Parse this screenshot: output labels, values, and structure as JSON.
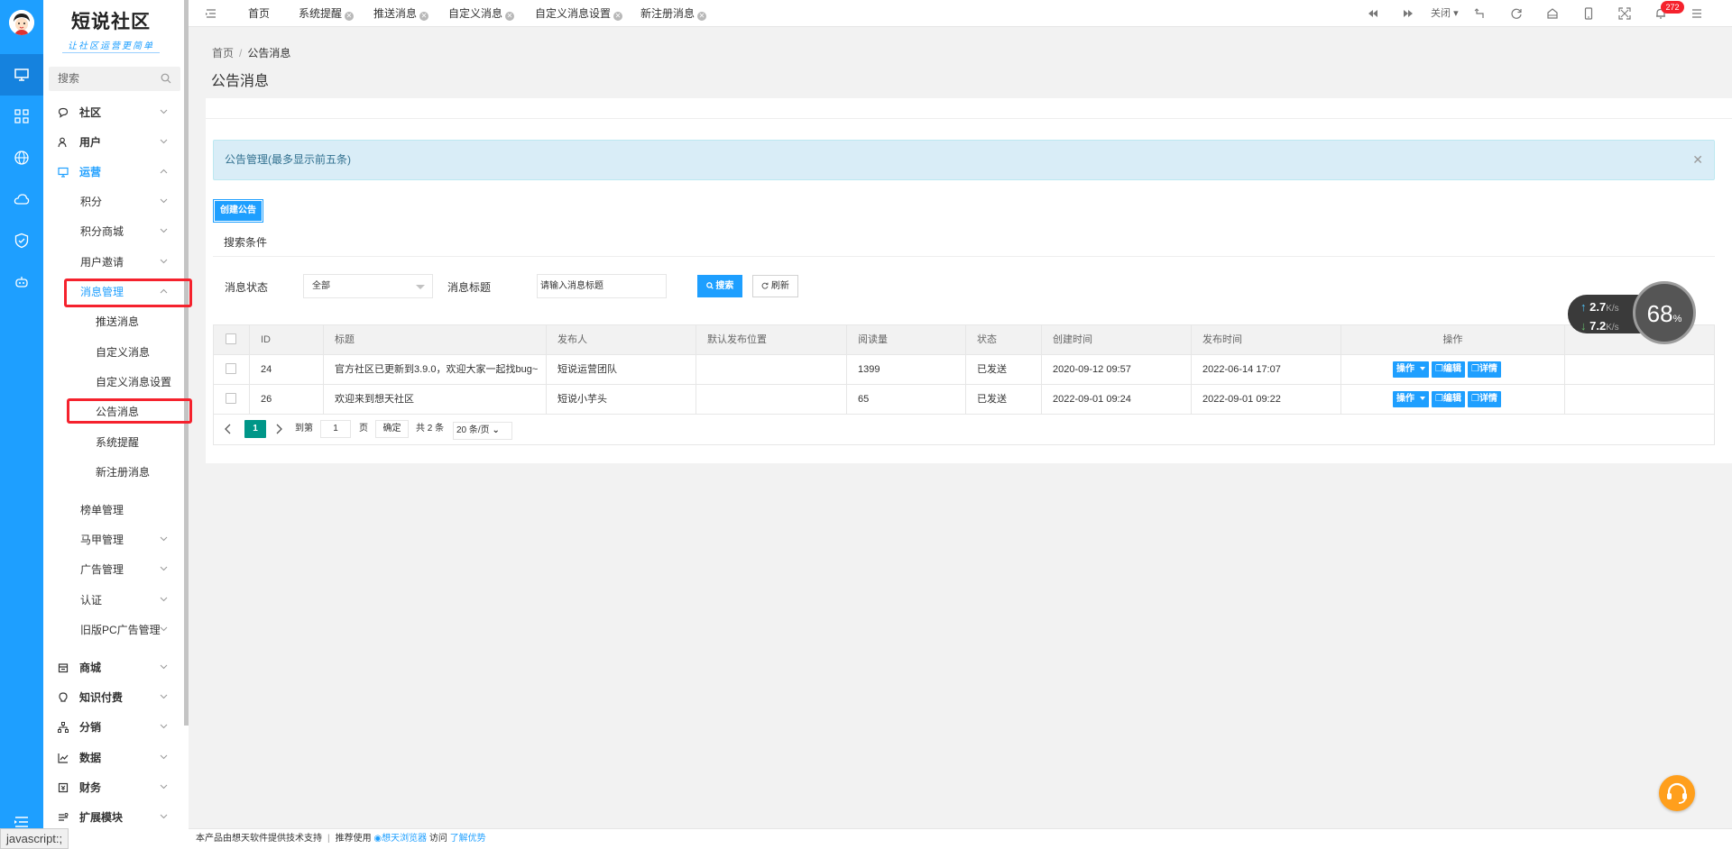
{
  "brand": {
    "title": "短说社区",
    "slogan": "让社区运营更简单"
  },
  "search": {
    "placeholder": "搜索"
  },
  "menu": [
    {
      "label": "社区",
      "icon": "chat-icon"
    },
    {
      "label": "用户",
      "icon": "users-icon"
    },
    {
      "label": "运营",
      "icon": "monitor-icon"
    },
    {
      "label": "积分"
    },
    {
      "label": "积分商城"
    },
    {
      "label": "用户邀请"
    },
    {
      "label": "消息管理"
    },
    {
      "label": "推送消息"
    },
    {
      "label": "自定义消息"
    },
    {
      "label": "自定义消息设置"
    },
    {
      "label": "公告消息"
    },
    {
      "label": "系统提醒"
    },
    {
      "label": "新注册消息"
    },
    {
      "label": "榜单管理"
    },
    {
      "label": "马甲管理"
    },
    {
      "label": "广告管理"
    },
    {
      "label": "认证"
    },
    {
      "label": "旧版PC广告管理"
    },
    {
      "label": "商城",
      "icon": "shop-icon"
    },
    {
      "label": "知识付费",
      "icon": "bulb-icon"
    },
    {
      "label": "分销",
      "icon": "network-icon"
    },
    {
      "label": "数据",
      "icon": "chart-icon"
    },
    {
      "label": "财务",
      "icon": "finance-icon"
    },
    {
      "label": "扩展模块",
      "icon": "extension-icon"
    }
  ],
  "tabs": [
    "首页",
    "系统提醒",
    "推送消息",
    "自定义消息",
    "自定义消息设置",
    "新注册消息"
  ],
  "topbar": {
    "close_label": "关闭",
    "badge": "272"
  },
  "breadcrumb": {
    "home": "首页",
    "current": "公告消息"
  },
  "page_title": "公告消息",
  "notice": "公告管理(最多显示前五条)",
  "create_button": "创建公告",
  "search_section": {
    "title": "搜索条件",
    "status_label": "消息状态",
    "status_value": "全部",
    "title_label": "消息标题",
    "title_placeholder": "请输入消息标题",
    "search_button": "搜索",
    "refresh_button": "刷新"
  },
  "table": {
    "headers": [
      "ID",
      "标题",
      "发布人",
      "默认发布位置",
      "阅读量",
      "状态",
      "创建时间",
      "发布时间",
      "操作"
    ],
    "rows": [
      {
        "id": "24",
        "title": "官方社区已更新到3.9.0，欢迎大家一起找bug~",
        "publisher": "短说运营团队",
        "position": "",
        "reads": "1399",
        "status": "已发送",
        "created": "2020-09-12 09:57",
        "published": "2022-06-14 17:07"
      },
      {
        "id": "26",
        "title": "欢迎来到想天社区",
        "publisher": "短说小芋头",
        "position": "",
        "reads": "65",
        "status": "已发送",
        "created": "2022-09-01 09:24",
        "published": "2022-09-01 09:22"
      }
    ],
    "op_labels": {
      "action": "操作",
      "edit": "编辑",
      "detail": "详情"
    }
  },
  "pager": {
    "current": "1",
    "goto_label": "到第",
    "page_input": "1",
    "page_unit": "页",
    "confirm": "确定",
    "total": "共 2 条",
    "page_size": "20 条/页"
  },
  "speed": {
    "up": "2.7",
    "down": "7.2",
    "unit": "K/s",
    "percent": "68",
    "percent_sign": "%"
  },
  "footer": {
    "text1": "本产品由想天软件提供技术支持",
    "sep": "|",
    "text2": "推荐使用",
    "browser": "想天浏览器",
    "text3": "访问",
    "more": "了解优势"
  },
  "status_bar": "javascript:;"
}
